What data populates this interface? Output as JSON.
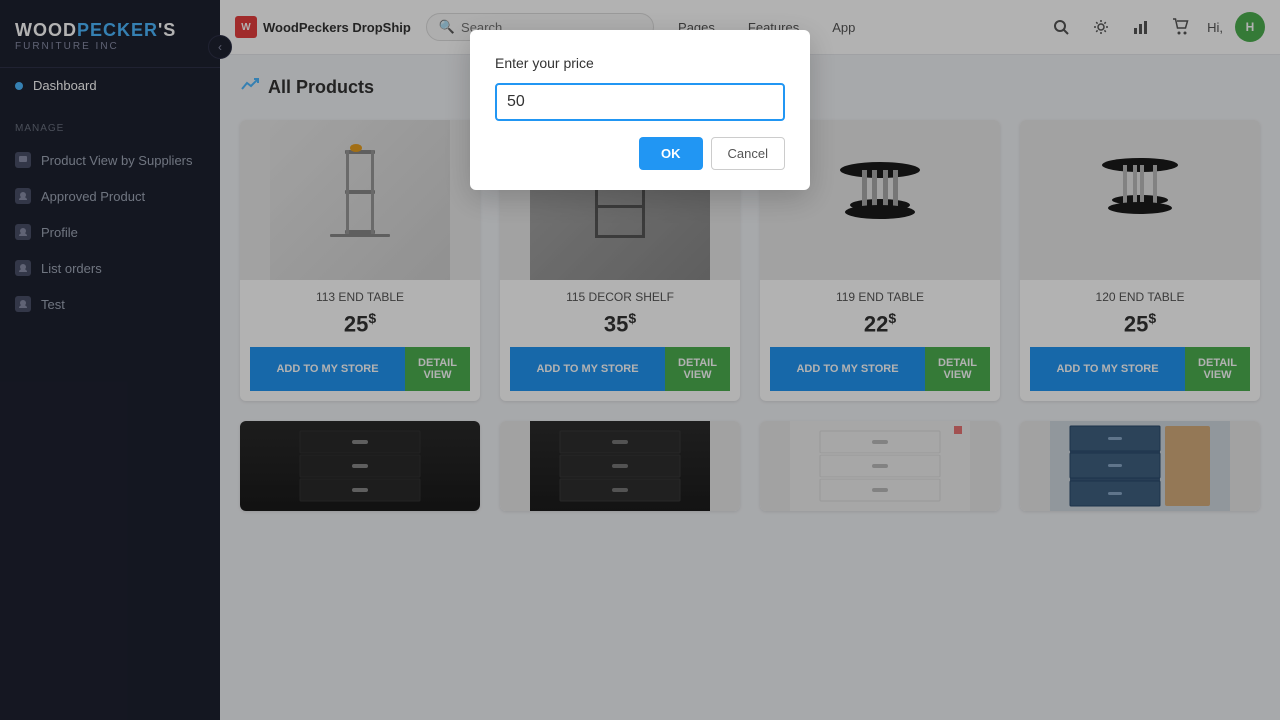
{
  "brand": {
    "icon_text": "W",
    "name": "WoodPeckers DropShip",
    "logo_line1": "WOODPECKER'S",
    "logo_line2": "FURNITURE INC"
  },
  "search": {
    "placeholder": "Search"
  },
  "nav_tabs": [
    {
      "label": "Pages"
    },
    {
      "label": "Features"
    },
    {
      "label": "App"
    }
  ],
  "topbar_right": {
    "hi_label": "Hi,"
  },
  "sidebar": {
    "manage_label": "MANAGE",
    "items": [
      {
        "label": "Dashboard",
        "type": "dot"
      },
      {
        "label": "Product View by Suppliers",
        "type": "icon"
      },
      {
        "label": "Approved Product",
        "type": "icon"
      },
      {
        "label": "Profile",
        "type": "icon"
      },
      {
        "label": "List orders",
        "type": "icon"
      },
      {
        "label": "Test",
        "type": "icon"
      }
    ]
  },
  "page": {
    "title": "All Products"
  },
  "products": [
    {
      "name": "113 END TABLE",
      "price": "25",
      "currency": "$"
    },
    {
      "name": "115 DECOR SHELF",
      "price": "35",
      "currency": "$"
    },
    {
      "name": "119 END TABLE",
      "price": "22",
      "currency": "$"
    },
    {
      "name": "120 END TABLE",
      "price": "25",
      "currency": "$"
    }
  ],
  "buttons": {
    "add_to_store": "ADD TO MY STORE",
    "detail_view": "DETAIL VIEW"
  },
  "modal": {
    "title": "Enter your price",
    "input_value": "50",
    "ok_label": "OK",
    "cancel_label": "Cancel"
  }
}
